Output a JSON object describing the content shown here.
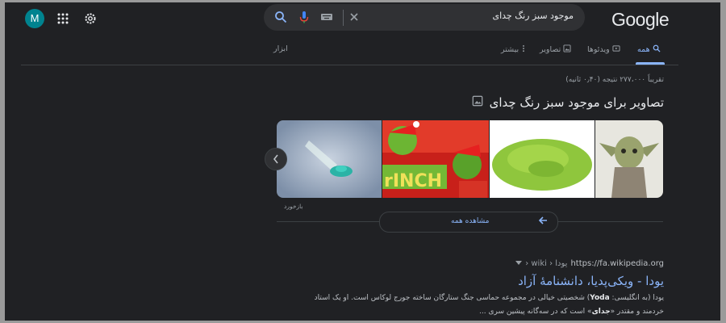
{
  "header": {
    "logo_text": "Google",
    "search_query": "موجود سبز رنگ چدای",
    "avatar_letter": "M"
  },
  "tabs": [
    {
      "label": "همه",
      "active": true,
      "icon": "search-icon"
    },
    {
      "label": "ویدئوها",
      "active": false,
      "icon": "video-icon"
    },
    {
      "label": "تصاویر",
      "active": false,
      "icon": "image-icon"
    },
    {
      "label": "بیشتر",
      "active": false,
      "icon": "more-vert-icon"
    },
    {
      "label": "ابزار",
      "active": false,
      "icon": ""
    }
  ],
  "result_stats": "تقریباً ۲۷۷،۰۰۰ نتیجه (۰٫۴۰ ثانیه)",
  "images_section": {
    "heading": "تصاویر برای موجود سبز رنگ چدای",
    "feedback": "بازخورد",
    "see_all": "مشاهده همه"
  },
  "result": {
    "cite_url": "https://fa.wikipedia.org",
    "cite_path": "› wiki › یودا",
    "title": "یودا - ویکی‌پدیا، دانشنامهٔ آزاد",
    "snippet_line1_pre": "یودا (به انگلیسی: ",
    "snippet_line1_bold": "Yoda",
    "snippet_line1_post": ") شخصیتی خیالی در مجموعه حماسی جنگ ستارگان ساخته جورج لوکاس است. او یک استاد",
    "snippet_line2_pre": "خردمند و مقتدر «",
    "snippet_line2_bold": "جدای",
    "snippet_line2_post": "» است که در سه‌گانه پیشین سری ..."
  },
  "colors": {
    "background": "#202124",
    "accent": "#8ab4f8",
    "text": "#e8eaed",
    "muted": "#9aa0a6"
  }
}
